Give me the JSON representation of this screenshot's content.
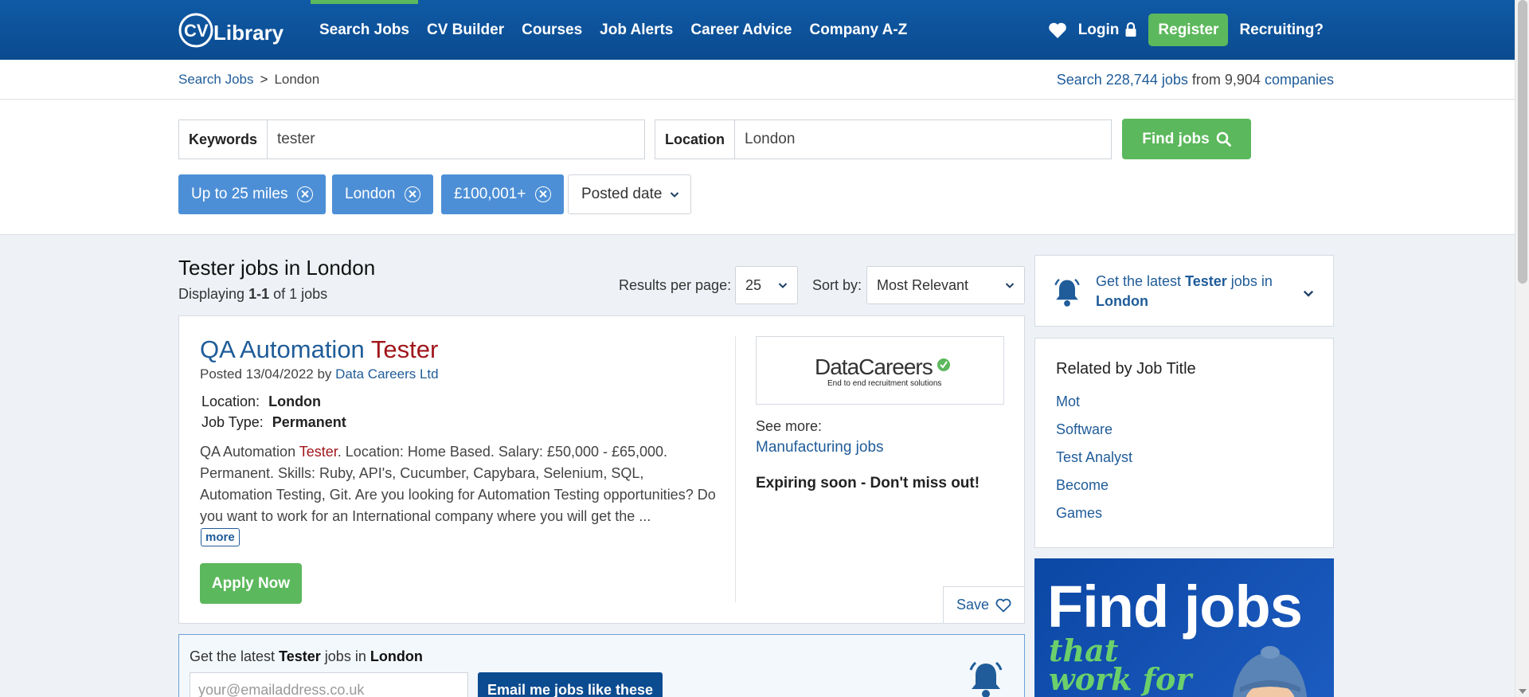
{
  "header": {
    "logo_text": "CV-Library",
    "nav": [
      "Search Jobs",
      "CV Builder",
      "Courses",
      "Job Alerts",
      "Career Advice",
      "Company A-Z"
    ],
    "login": "Login",
    "register": "Register",
    "recruiting": "Recruiting?"
  },
  "breadcrumb": {
    "parent": "Search Jobs",
    "separator": ">",
    "current": "London"
  },
  "stats": {
    "prefix": "Search",
    "jobs": "228,744 jobs",
    "from": "from",
    "companies_count": "9,904",
    "companies": "companies"
  },
  "search": {
    "keywords_label": "Keywords",
    "keywords_value": "tester",
    "location_label": "Location",
    "location_value": "London",
    "find_button": "Find jobs"
  },
  "filters": {
    "chips": [
      "Up to 25 miles",
      "London",
      "£100,001+"
    ],
    "posted_date": "Posted date"
  },
  "results": {
    "title": "Tester jobs in London",
    "displaying_prefix": "Displaying",
    "range": "1-1",
    "of_text": "of 1 jobs",
    "per_page_label": "Results per page:",
    "per_page_value": "25",
    "sort_label": "Sort by:",
    "sort_value": "Most Relevant"
  },
  "job": {
    "title_part1": "QA Automation",
    "title_part2": "Tester",
    "posted_prefix": "Posted 13/04/2022 by",
    "company": "Data Careers Ltd",
    "location_label": "Location:",
    "location_value": "London",
    "type_label": "Job Type:",
    "type_value": "Permanent",
    "desc_pre": "QA Automation",
    "desc_hl": "Tester",
    "desc_post": ". Location: Home Based. Salary: £50,000 - £65,000. Permanent. Skills: Ruby, API's, Cucumber, Capybara, Selenium, SQL, Automation Testing, Git. Are you looking for Automation Testing opportunities? Do you want to work for an International company where you will get the ...",
    "more": "more",
    "apply": "Apply Now",
    "logo_name": "DataCareers",
    "logo_tagline": "End to end recruitment solutions",
    "see_more": "See more:",
    "see_more_link": "Manufacturing jobs",
    "expiring": "Expiring soon - Don't miss out!",
    "save": "Save"
  },
  "email_alert": {
    "text_pre": "Get the latest",
    "keyword": "Tester",
    "text_mid": "jobs in",
    "location": "London",
    "placeholder": "your@emailaddress.co.uk",
    "button": "Email me jobs like these"
  },
  "sidebar": {
    "alert_pre": "Get the latest",
    "alert_keyword": "Tester",
    "alert_mid": "jobs in",
    "alert_location": "London",
    "related_title": "Related by Job Title",
    "related": [
      "Mot",
      "Software",
      "Test Analyst",
      "Become",
      "Games"
    ],
    "ad_title": "Find jobs",
    "ad_sub": "that work for you"
  },
  "colors": {
    "brand_blue": "#0b4b8f",
    "accent_green": "#5cb85c",
    "chip_blue": "#4d8fd6",
    "highlight_red": "#a0171c"
  }
}
